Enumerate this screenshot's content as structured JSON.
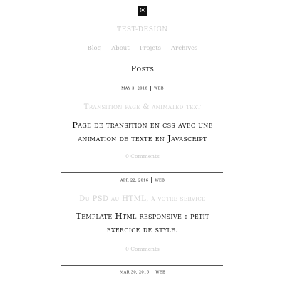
{
  "logo": {
    "text": "[ø]"
  },
  "site_title": "TEST-DESIGN",
  "nav": [
    "Blog",
    "About",
    "Projets",
    "Archives"
  ],
  "section_title": "Posts",
  "posts": [
    {
      "date": "MAY 3, 2016",
      "category": "WEB",
      "title": "Transition page & animated text",
      "excerpt": "Page de transition en css avec une animation de texte en Javascript",
      "comments": "0 Comments"
    },
    {
      "date": "APR 22, 2016",
      "category": "WEB",
      "title": "Du PSD au HTML, à votre service",
      "excerpt": "Template Html responsive : petit exercice de style.",
      "comments": "0 Comments"
    },
    {
      "date": "MAR 30, 2016",
      "category": "WEB"
    }
  ]
}
